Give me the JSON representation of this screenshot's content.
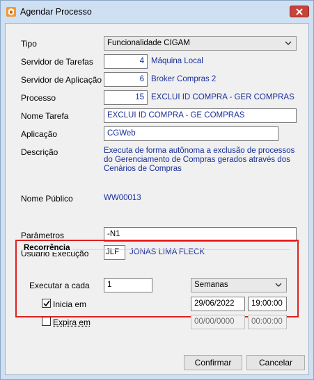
{
  "window": {
    "title": "Agendar Processo"
  },
  "form": {
    "tipo": {
      "label": "Tipo",
      "value": "Funcionalidade CIGAM"
    },
    "servidor_tarefas": {
      "label": "Servidor de Tarefas",
      "code": "4",
      "name": "Máquina Local"
    },
    "servidor_aplicacao": {
      "label": "Servidor de Aplicação",
      "code": "6",
      "name": "Broker Compras 2"
    },
    "processo": {
      "label": "Processo",
      "code": "15",
      "name": "EXCLUI ID COMPRA - GER COMPRAS"
    },
    "nome_tarefa": {
      "label": "Nome Tarefa",
      "value": "EXCLUI ID COMPRA - GE COMPRAS"
    },
    "aplicacao": {
      "label": "Aplicação",
      "value": "CGWeb"
    },
    "descricao": {
      "label": "Descrição",
      "value": "Executa de forma autônoma a exclusão de processos do Gerenciamento de Compras gerados através dos Cenários de Compras"
    },
    "nome_publico": {
      "label": "Nome Público",
      "value": "WW00013"
    },
    "parametros": {
      "label": "Parâmetros",
      "value": "-N1"
    },
    "usuario_execucao": {
      "label": "Usuário Execução",
      "code": "JLF",
      "name": "JONAS LIMA FLECK"
    }
  },
  "recorrencia": {
    "title": "Recorrência",
    "executar_label": "Executar a cada",
    "executar_value": "1",
    "period": "Semanas",
    "inicia": {
      "label": "Inicia em",
      "checked": true,
      "date": "29/06/2022",
      "time": "19:00:00"
    },
    "expira": {
      "label": "Expira em",
      "checked": false,
      "date": "00/00/0000",
      "time": "00:00:00"
    }
  },
  "buttons": {
    "confirm": "Confirmar",
    "cancel": "Cancelar"
  },
  "colors": {
    "value_text": "#1a2f9a",
    "highlight": "#e02020",
    "titlebar": "#cfe0f3",
    "close": "#c7433a"
  },
  "icons": {
    "app": "app-logo-icon",
    "close": "close-icon",
    "dropdown": "chevron-down-icon",
    "check": "check-icon"
  }
}
